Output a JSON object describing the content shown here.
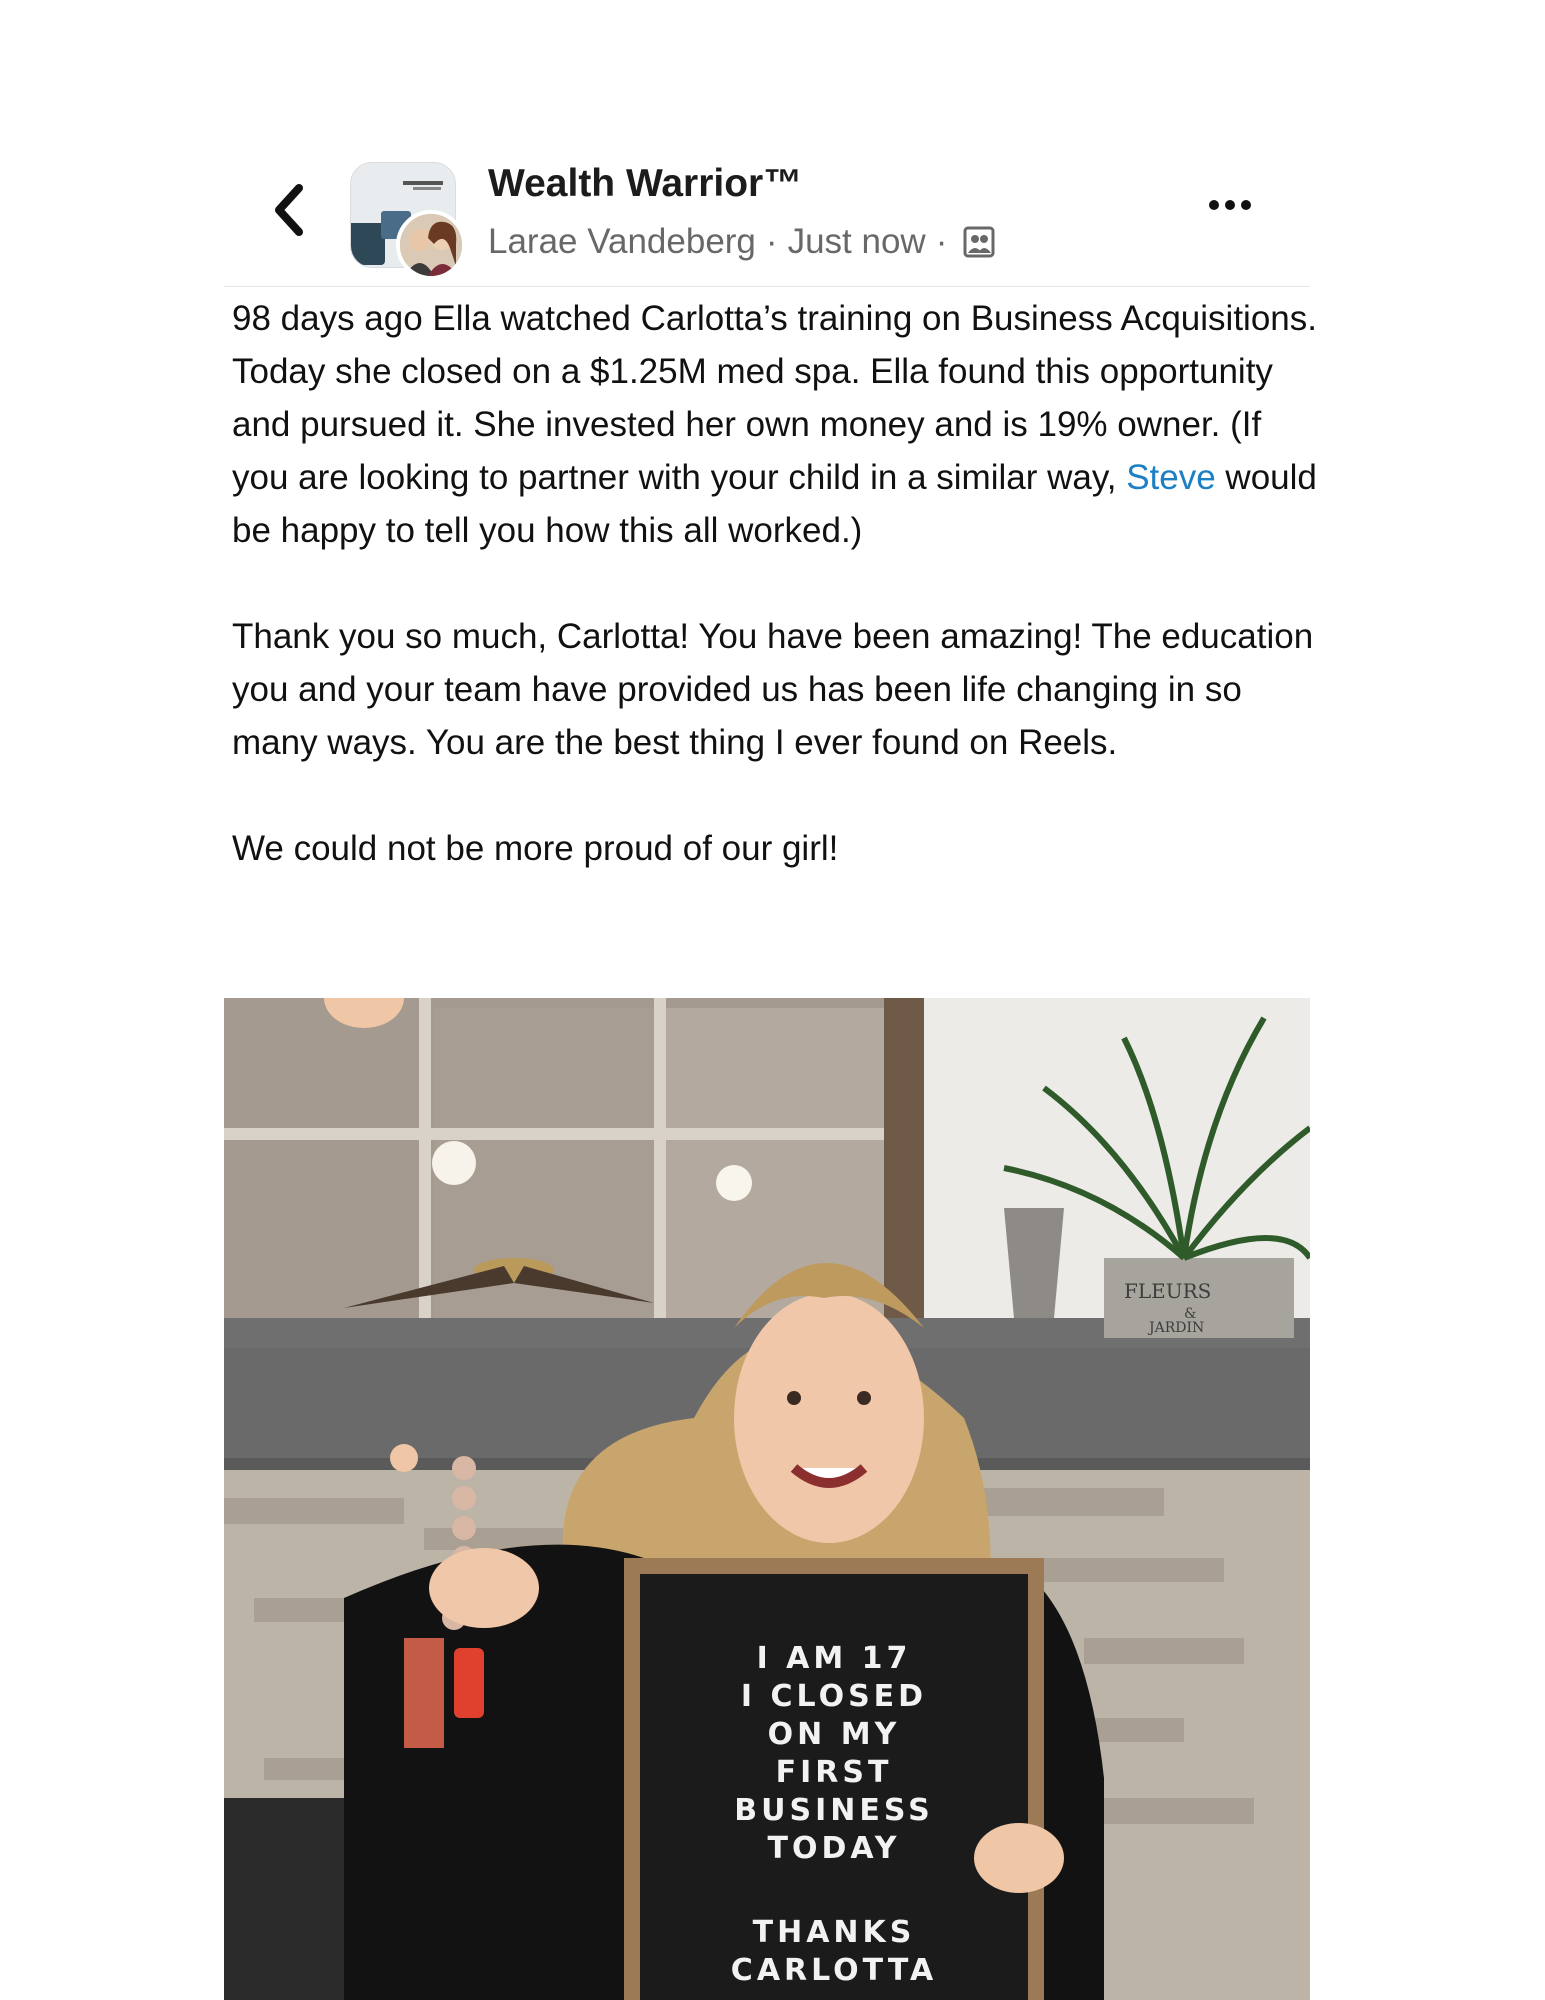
{
  "header": {
    "back_icon": "chevron-left-icon",
    "group_name": "Wealth Warrior™",
    "author": "Larae Vandeberg",
    "separator": "·",
    "time": "Just now",
    "audience_icon": "members-icon",
    "more_icon": "more-horizontal-icon"
  },
  "post": {
    "p1_before": "98 days ago Ella watched Carlotta’s training on Business Acquisitions. Today she closed on a $1.25M med spa. Ella found this opportunity and pursued it. She invested her own money and is 19% owner. (If you are looking to partner with your child in a similar way, ",
    "mention": "Steve",
    "p1_after": " would be happy to tell you how this all worked.)",
    "p2": "Thank you so much, Carlotta! You have been amazing! The education you and your team have provided us has been life changing in so many ways. You are the best thing I ever found on Reels.",
    "p3": "We could not be more proud of our girl!"
  },
  "photo": {
    "letterboard_lines": [
      "I AM 17",
      "I CLOSED",
      "ON MY",
      "FIRST",
      "BUSINESS",
      "TODAY",
      "",
      "THANKS",
      "CARLOTTA"
    ],
    "pot_label_1": "FLEURS",
    "pot_label_2": "&",
    "pot_label_3": "JARDIN"
  },
  "colors": {
    "mention": "#1d7fc4",
    "meta_text": "#686868"
  }
}
